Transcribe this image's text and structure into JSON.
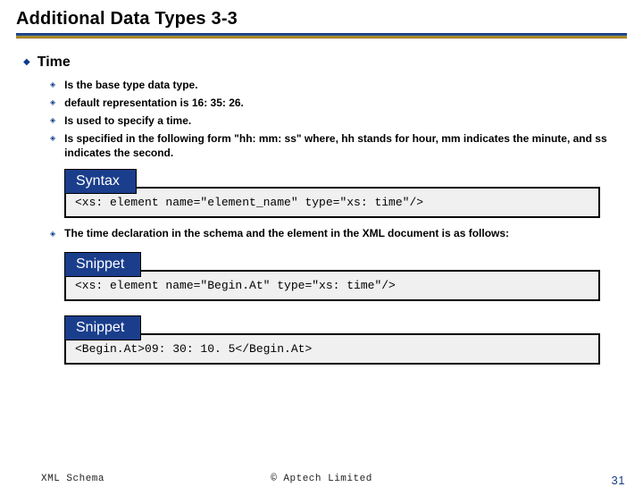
{
  "title": "Additional Data Types 3-3",
  "section": {
    "heading": "Time"
  },
  "bullets": [
    "Is the base type data type.",
    "default representation is 16: 35: 26.",
    "Is used to specify a time.",
    "Is specified in the following form \"hh: mm: ss\" where, hh stands for hour, mm indicates the minute, and ss indicates the second."
  ],
  "labels": {
    "syntax": "Syntax",
    "snippet": "Snippet"
  },
  "code": {
    "syntax": "<xs: element name=\"element_name\" type=\"xs: time\"/>",
    "snippet1": "<xs: element name=\"Begin.At\" type=\"xs: time\"/>",
    "snippet2": "<Begin.At>09: 30: 10. 5</Begin.At>"
  },
  "midline": "The time declaration in the schema and the element in the XML document is as follows:",
  "footer": {
    "left": "XML Schema",
    "center": "© Aptech Limited",
    "page": "31"
  }
}
